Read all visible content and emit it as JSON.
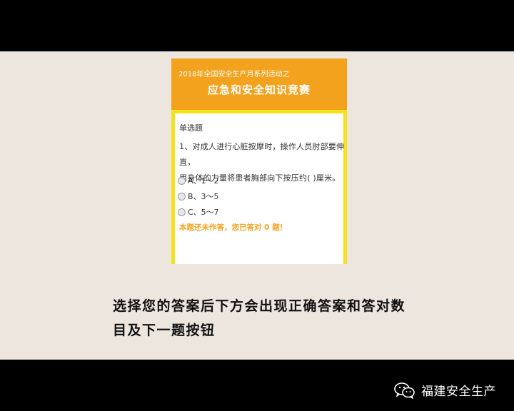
{
  "quiz": {
    "header": {
      "subtitle": "2018年全国安全生产月系列活动之",
      "title": "应急和安全知识竞赛"
    },
    "question_type": "单选题",
    "question_line1": "1、对成人进行心脏按摩时，操作人员肘部要伸直，",
    "question_line2": "用身体的力量将患者胸部向下按压约( )厘米。",
    "options": [
      {
        "label": "A、1～2"
      },
      {
        "label": "B、3～5"
      },
      {
        "label": "C、5～7"
      }
    ],
    "status_text": "本题还未作答，您已答对 0 题！"
  },
  "caption": {
    "line1": "选择您的答案后下方会出现正确答案和答对数",
    "line2": "目及下一题按钮"
  },
  "brand": {
    "name": "福建安全生产",
    "icon": "wechat-icon"
  },
  "colors": {
    "header": "#f3a21d",
    "border": "#f4e21a",
    "stage": "#ede6df"
  }
}
